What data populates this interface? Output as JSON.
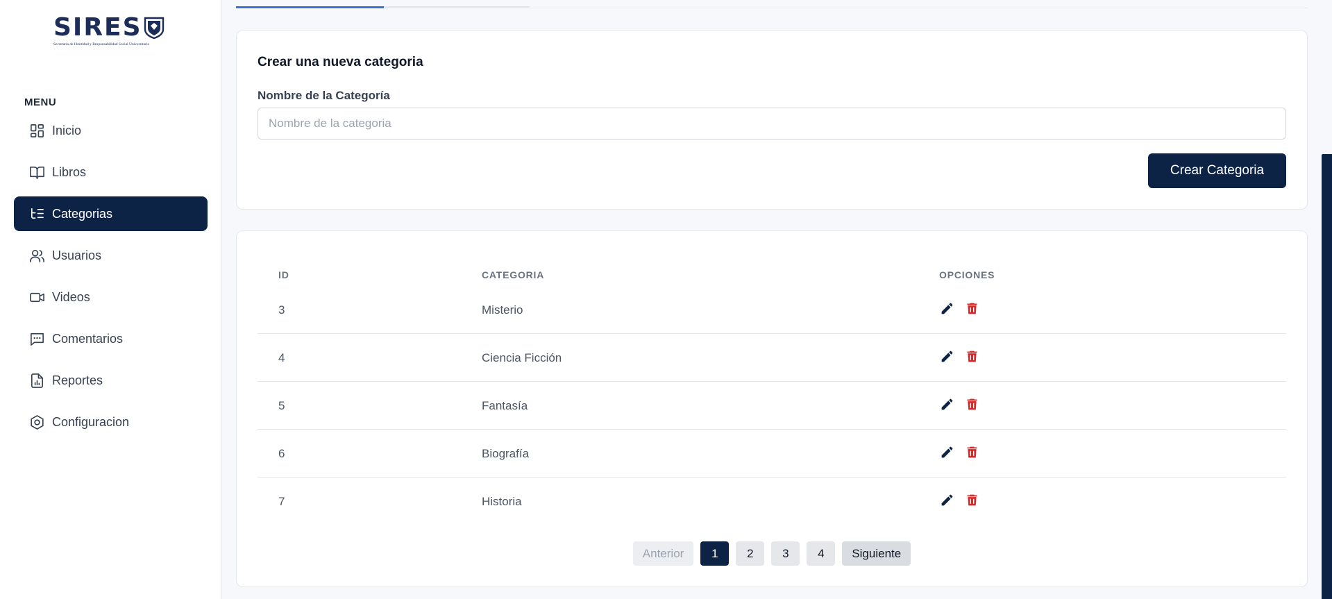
{
  "brand": {
    "name": "SIRES",
    "subtitle": "Secretaría de Identidad y Responsabilidad Social Universitaria"
  },
  "sidebar": {
    "menu_title": "MENU",
    "items": [
      {
        "label": "Inicio",
        "icon": "dashboard-icon"
      },
      {
        "label": "Libros",
        "icon": "book-icon"
      },
      {
        "label": "Categorias",
        "icon": "list-tree-icon",
        "active": true
      },
      {
        "label": "Usuarios",
        "icon": "users-icon"
      },
      {
        "label": "Videos",
        "icon": "video-icon"
      },
      {
        "label": "Comentarios",
        "icon": "comment-icon"
      },
      {
        "label": "Reportes",
        "icon": "report-icon"
      },
      {
        "label": "Configuracion",
        "icon": "settings-icon"
      }
    ]
  },
  "form": {
    "title": "Crear una nueva categoria",
    "label": "Nombre de la Categoría",
    "placeholder": "Nombre de la categoria",
    "value": "",
    "submit_label": "Crear Categoria"
  },
  "table": {
    "headers": [
      "ID",
      "CATEGORIA",
      "OPCIONES"
    ],
    "rows": [
      {
        "id": "3",
        "categoria": "Misterio"
      },
      {
        "id": "4",
        "categoria": "Ciencia Ficción"
      },
      {
        "id": "5",
        "categoria": "Fantasía"
      },
      {
        "id": "6",
        "categoria": "Biografía"
      },
      {
        "id": "7",
        "categoria": "Historia"
      }
    ]
  },
  "pagination": {
    "prev_label": "Anterior",
    "pages": [
      "1",
      "2",
      "3",
      "4"
    ],
    "current_page": "1",
    "next_label": "Siguiente"
  },
  "colors": {
    "primary": "#0d2346",
    "accent": "#3b6fd8",
    "danger": "#dc2626",
    "brand": "#1c2d5a"
  }
}
